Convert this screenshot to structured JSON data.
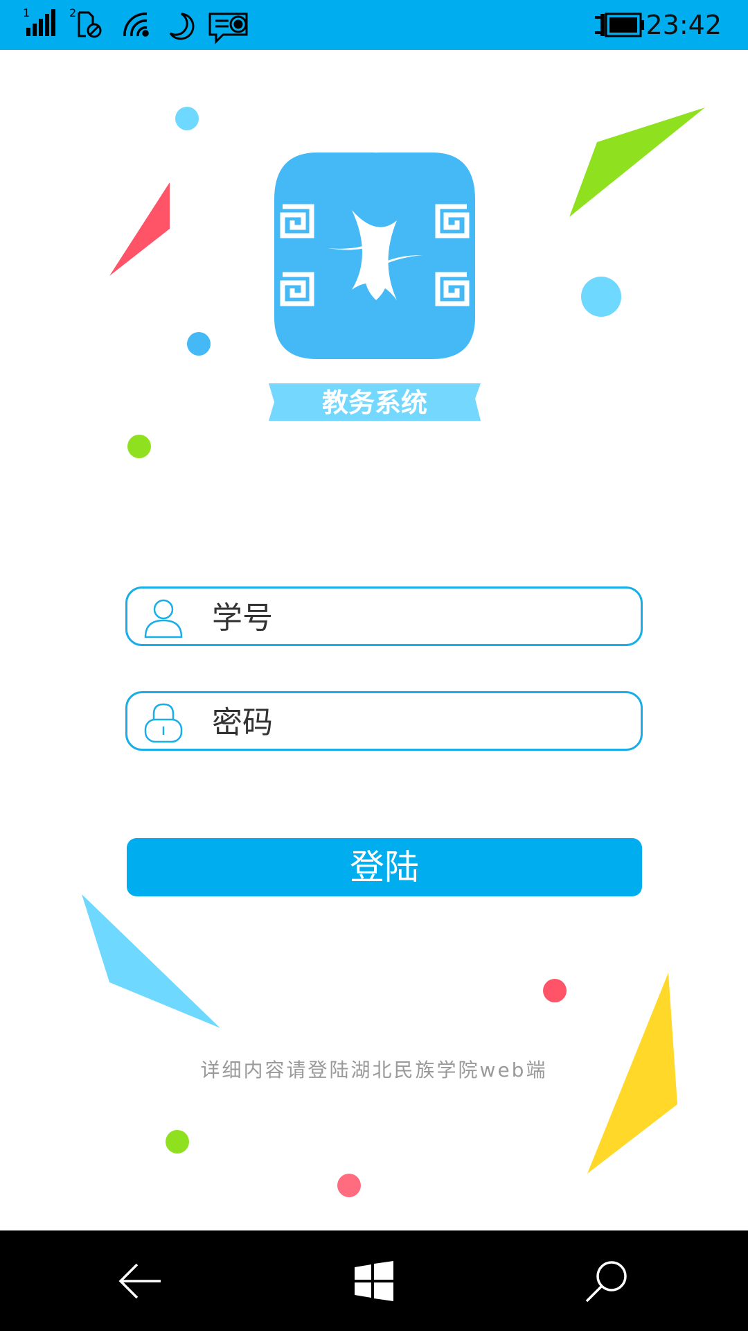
{
  "status_bar": {
    "time": "23:42",
    "sim1_label": "1",
    "sim2_label": "2",
    "icons": [
      "signal-icon",
      "sim2-no-signal-icon",
      "wifi-icon",
      "quiet-hours-moon-icon",
      "notification-icon",
      "battery-charging-icon"
    ]
  },
  "logo": {
    "banner_text": "教务系统",
    "colors": {
      "primary": "#45b9f5",
      "banner": "#74d7fd"
    }
  },
  "form": {
    "student_id_placeholder": "学号",
    "password_placeholder": "密码",
    "login_label": "登陆"
  },
  "footer": {
    "note": "详细内容请登陆湖北民族学院web端"
  },
  "nav_bar": {
    "icons": [
      "back-arrow-icon",
      "windows-start-icon",
      "search-icon"
    ]
  },
  "colors": {
    "accent": "#00adee",
    "field_border": "#1aaee8",
    "note_text": "#9a9a9a",
    "decor_red": "#ff5468",
    "decor_green": "#8fe11f",
    "decor_lightblue": "#6fd8fe",
    "decor_yellow": "#ffd82a"
  }
}
